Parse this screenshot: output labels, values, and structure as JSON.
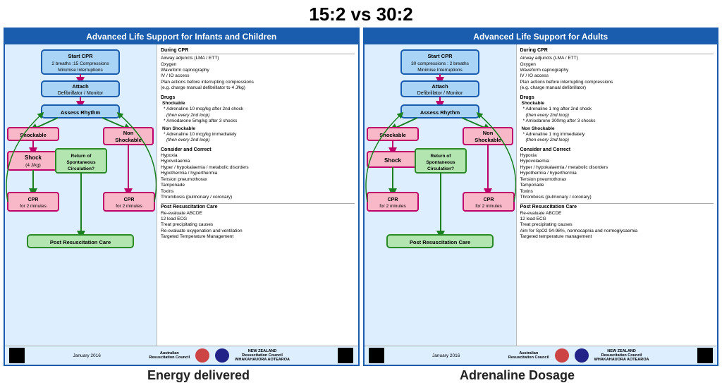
{
  "header": {
    "title": "15:2 vs 30:2"
  },
  "panels": [
    {
      "id": "infants",
      "title": "Advanced Life Support for Infants and Children",
      "start_cpr": {
        "line1": "Start CPR",
        "line2": "2 breaths :15 Compressions",
        "line3": "Minimise Interruptions"
      },
      "attach": "Attach\nDefibrillator / Monitor",
      "assess": "Assess Rhythm",
      "shockable": "Shockable",
      "non_shockable": "Non\nShockable",
      "shock": "Shock\n(4 J/kg)",
      "rosc": "Return of\nSpontaneous\nCirculation?",
      "cpr_left": "CPR\nfor 2 minutes",
      "cpr_right": "CPR\nfor 2 minutes",
      "post_care": "Post Resuscitation Care",
      "notes": {
        "during_cpr_title": "During CPR",
        "during_cpr": [
          "Airway adjuncts (LMA / ETT)",
          "Oxygen",
          "Waveform capnography",
          "IV / IO access",
          "Plan actions before interrupting compressions",
          "(e.g. charge manual defibrillator to 4 J/kg)"
        ],
        "drugs_title": "Drugs",
        "shockable_title": "Shockable",
        "shockable_drugs": [
          "* Adrenaline 10 mcg/kg after 2nd shock",
          "(then every 2nd loop)",
          "* Amiodarone 5mg/kg after 3 shocks"
        ],
        "non_shockable_title": "Non Shockable",
        "non_shockable_drugs": [
          "* Adrenaline 10 mcg/kg immediately",
          "(then every 2nd loop)"
        ],
        "consider_title": "Consider and Correct",
        "consider_items": [
          "Hypoxia",
          "Hypovolaemia",
          "Hyper / hypokalaemia / metabolic disorders",
          "Hypothermia / hyperthermia",
          "Tension pneumothorax",
          "Tamponade",
          "Toxins",
          "Thrombosis (pulmonary / coronary)"
        ],
        "post_title": "Post Resuscitation Care",
        "post_items": [
          "Re-evaluate ABCDE",
          "12 lead ECG",
          "Treat precipitating causes",
          "Re-evaluate oxygenation and ventilation",
          "Targeted Temperature Management"
        ]
      },
      "footer": {
        "date": "January 2016",
        "org1": "Australian\nResuscitation Council",
        "org2": "NEW ZEALAND\nResuscitation Council\nWHAKAHAUORA AOTEAROA"
      }
    },
    {
      "id": "adults",
      "title": "Advanced Life Support for Adults",
      "start_cpr": {
        "line1": "Start CPR",
        "line2": "30 compressions : 2 breaths",
        "line3": "Minimise Interruptions"
      },
      "attach": "Attach\nDefibrillator / Monitor",
      "assess": "Assess Rhythm",
      "shockable": "Shockable",
      "non_shockable": "Non\nShockable",
      "shock": "Shock",
      "rosc": "Return of\nSpontaneous\nCirculation?",
      "cpr_left": "CPR\nfor 2 minutes",
      "cpr_right": "CPR\nfor 2 minutes",
      "post_care": "Post Resuscitation Care",
      "notes": {
        "during_cpr_title": "During CPR",
        "during_cpr": [
          "Airway adjuncts (LMA / ETT)",
          "Oxygen",
          "Waveform capnography",
          "IV / IO access",
          "Plan actions before interrupting compressions",
          "(e.g. charge manual defibrillator)"
        ],
        "drugs_title": "Drugs",
        "shockable_title": "Shockable",
        "shockable_drugs": [
          "* Adrenaline 1 mg after 2nd shock",
          "(then every 2nd loop)",
          "* Amiodarone 300mg after 3 shocks"
        ],
        "non_shockable_title": "Non Shockable",
        "non_shockable_drugs": [
          "* Adrenaline 1 mg immediately",
          "(then every 2nd loop)"
        ],
        "consider_title": "Consider and Correct",
        "consider_items": [
          "Hypoxia",
          "Hypovolaemia",
          "Hyper / hypokalaemia / metabolic disorders",
          "Hypothermia / hyperthermia",
          "Tension pneumothorax",
          "Tamponade",
          "Toxins",
          "Thrombosis (pulmonary / coronary)"
        ],
        "post_title": "Post Resuscitation Care",
        "post_items": [
          "Re-evaluate ABCDE",
          "12 lead ECG",
          "Treat precipitating causes",
          "Aim for SpO2 94-98%, normocapnia and normoglycaemia",
          "Targeted temperature management"
        ]
      },
      "footer": {
        "date": "January 2016",
        "org1": "Australian\nResuscitation Council",
        "org2": "NEW ZEALAND\nResuscitation Council\nWHAKAHAUORA AOTEAROA"
      }
    }
  ],
  "bottom_labels": {
    "left": "Energy delivered",
    "right": "Adrenaline Dosage"
  }
}
